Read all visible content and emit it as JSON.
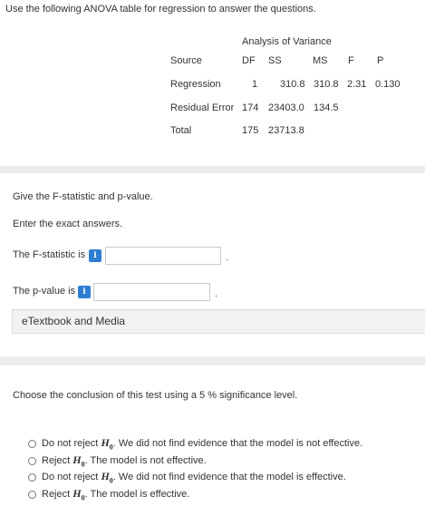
{
  "intro": "Use the following ANOVA table for regression to answer the questions.",
  "anova": {
    "title": "Analysis of Variance",
    "headers": [
      "Source",
      "DF",
      "SS",
      "MS",
      "F",
      "P"
    ],
    "rows": [
      [
        "Regression",
        "1",
        "310.8",
        "310.8",
        "2.31",
        "0.130"
      ],
      [
        "Residual Error",
        "174",
        "23403.0",
        "134.5",
        "",
        ""
      ],
      [
        "Total",
        "175",
        "23713.8",
        "",
        "",
        ""
      ]
    ]
  },
  "question1": {
    "prompt": "Give the F-statistic and p-value.",
    "instruction": "Enter the exact answers.",
    "f_label": "The F-statistic is",
    "p_label": "The p-value is",
    "f_value": "",
    "p_value": "",
    "info_glyph": "i",
    "trailing_dot": "."
  },
  "etextbook": "eTextbook and Media",
  "question2": {
    "prompt": "Choose the conclusion of this test using a 5 % significance level.",
    "options": [
      {
        "prefix": "Do not reject",
        "h": "H",
        "sub": "0",
        "suffix": ". We did not find evidence that the model is not effective."
      },
      {
        "prefix": "Reject",
        "h": "H",
        "sub": "0",
        "suffix": ". The model is not effective."
      },
      {
        "prefix": "Do not reject",
        "h": "H",
        "sub": "0",
        "suffix": ". We did not find evidence that the model is effective."
      },
      {
        "prefix": "Reject",
        "h": "H",
        "sub": "0",
        "suffix": ". The model is effective."
      }
    ]
  },
  "colors": {
    "info": "#2d7dd2",
    "band": "#ececec",
    "panel": "#f2f2f2"
  }
}
